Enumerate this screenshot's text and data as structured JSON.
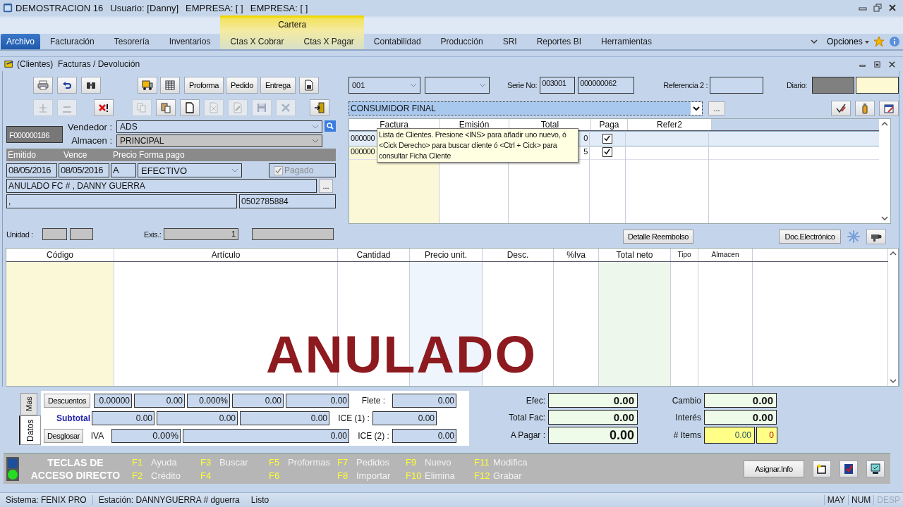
{
  "window": {
    "title": "DEMOSTRACION 16",
    "user": "Usuario: [Danny]",
    "company_1": "EMPRESA: [   ]",
    "company_2": "EMPRESA: [   ]"
  },
  "ribbon": {
    "group_label": "Cartera",
    "options": "Opciones",
    "tabs": [
      {
        "label": "Archivo",
        "selected": true,
        "group": false
      },
      {
        "label": "Facturación",
        "selected": false,
        "group": false
      },
      {
        "label": "Tesorería",
        "selected": false,
        "group": false
      },
      {
        "label": "Inventarios",
        "selected": false,
        "group": false
      },
      {
        "label": "Ctas X Cobrar",
        "selected": false,
        "group": true
      },
      {
        "label": "Ctas X Pagar",
        "selected": false,
        "group": true
      },
      {
        "label": "Contabilidad",
        "selected": false,
        "group": false
      },
      {
        "label": "Producción",
        "selected": false,
        "group": false
      },
      {
        "label": "SRI",
        "selected": false,
        "group": false
      },
      {
        "label": "Reportes BI",
        "selected": false,
        "group": false
      },
      {
        "label": "Herramientas",
        "selected": false,
        "group": false
      }
    ]
  },
  "document": {
    "title": "(Clientes)  Facturas / Devolución"
  },
  "toolbar": {
    "row_1": [
      {
        "kind": "icon"
      },
      {
        "kind": "icon"
      },
      {
        "kind": "icon"
      },
      {
        "kind": "icon"
      },
      {
        "kind": "icon"
      },
      {
        "kind": "text",
        "label": "Proforma"
      },
      {
        "kind": "text",
        "label": "Pedido"
      },
      {
        "kind": "text",
        "label": "Entrega"
      },
      {
        "kind": "icon"
      }
    ],
    "row_2": [
      {
        "kind": "icon",
        "disabled": true
      },
      {
        "kind": "icon",
        "disabled": true
      },
      {
        "kind": "icon",
        "disabled": false
      },
      {
        "kind": "icon",
        "disabled": true
      },
      {
        "kind": "icon",
        "disabled": false
      },
      {
        "kind": "icon",
        "disabled": false
      },
      {
        "kind": "icon",
        "disabled": true
      },
      {
        "kind": "icon",
        "disabled": true
      },
      {
        "kind": "icon",
        "disabled": true
      },
      {
        "kind": "icon",
        "disabled": true
      },
      {
        "kind": "icon",
        "disabled": false
      }
    ]
  },
  "form": {
    "invoice_no": "F000000186",
    "vendedor_label": "Vendedor :",
    "vendedor": "ADS",
    "almacen_label": "Almacen :",
    "almacen": "PRINCIPAL",
    "headers": [
      "Emitido",
      "Vence",
      "Precio",
      "Forma pago"
    ],
    "emitido": "08/05/2016",
    "vence": "08/05/2016",
    "precio": "A",
    "forma_pago": "EFECTIVO",
    "pagado": {
      "label": "Pagado",
      "checked": true,
      "disabled": true
    },
    "note": "ANULADO FC # , DANNY GUERRA",
    "more": "...",
    "address": ",",
    "id_number": "0502785884",
    "unidad_label": "Unidad :",
    "exis_label": "Exis.:",
    "exis": "1"
  },
  "header_right": {
    "series": "001",
    "serie_label": "Serie No:",
    "serie_1": "003001",
    "serie_2": "000000062",
    "ref_label": "Referencia 2 :",
    "diario_label": "Diario:",
    "client": "CONSUMIDOR FINAL",
    "more": "..."
  },
  "invoices": {
    "columns": [
      "Factura",
      "Emisión",
      "Total",
      "Paga",
      "Refer2"
    ],
    "rows": [
      {
        "factura": "000000",
        "total": "0",
        "paga": true,
        "selected": true
      },
      {
        "factura": "000000",
        "total": "5",
        "paga": true,
        "selected": false
      }
    ]
  },
  "tooltip": "Lista de Clientes. Presione <INS> para añadir uno nuevo, ó <Cick Derecho> para buscar cliente ó <Ctrl + Cick> para consultar Ficha Cliente",
  "buttons_right": [
    "Detalle Reembolso",
    "Doc.Electrónico"
  ],
  "items": {
    "columns": [
      "Código",
      "Artículo",
      "Cantidad",
      "Precio unit.",
      "Desc.",
      "%Iva",
      "Total  neto",
      "Tipo",
      "Almacen"
    ],
    "stamp": "ANULADO"
  },
  "totals": {
    "tabs": [
      {
        "label": "Mas",
        "selected": false
      },
      {
        "label": "Datos",
        "selected": true
      }
    ],
    "descuentos": "Descuentos",
    "discount_values": [
      "0.00000",
      "0.00",
      "0.000%",
      "0.00",
      "0.00"
    ],
    "subtotal_label": "Subtotal",
    "subtotal_values": [
      "0.00",
      "0.00",
      "0.00"
    ],
    "desglosar": "Desglosar",
    "iva_label": "IVA",
    "iva_values": [
      "0.00%",
      "0.00"
    ],
    "extras": [
      {
        "label": "Flete :",
        "value": "0.00"
      },
      {
        "label": "ICE (1) :",
        "value": "0.00"
      },
      {
        "label": "ICE (2) :",
        "value": "0.00"
      }
    ]
  },
  "payment": {
    "left": [
      {
        "label": "Efec:",
        "value": "0.00"
      },
      {
        "label": "Total Fac:",
        "value": "0.00"
      },
      {
        "label": "A Pagar :",
        "value": "0.00"
      }
    ],
    "cambio_label": "Cambio",
    "cambio": "0.00",
    "interes_label": "Interés",
    "interes": "0.00",
    "items_label": "# Items",
    "items_qty": "0.00",
    "items_count": "0"
  },
  "shortcuts": {
    "title_1": "TECLAS DE",
    "title_2": "ACCESO DIRECTO",
    "keys": [
      {
        "key": "F1",
        "label": "Ayuda"
      },
      {
        "key": "F2",
        "label": "Crédito"
      },
      {
        "key": "F3",
        "label": "Buscar"
      },
      {
        "key": "F4"
      },
      {
        "key": "F5",
        "label": "Proformas"
      },
      {
        "key": "F6"
      },
      {
        "key": "F7",
        "label": "Pedidos"
      },
      {
        "key": "F8",
        "label": "Importar"
      },
      {
        "key": "F9",
        "label": "Nuevo"
      },
      {
        "key": "F10",
        "label": "Elimina"
      },
      {
        "key": "F11",
        "label": "Modifica"
      },
      {
        "key": "F12",
        "label": "Grabar"
      }
    ],
    "assign": "Asignar.Info"
  },
  "status_bar": {
    "items": [
      "Sistema: FENIX PRO",
      "Estación: DANNYGUERRA # dguerra",
      "Listo"
    ],
    "indicators": [
      {
        "label": "MAY",
        "on": true
      },
      {
        "label": "NUM",
        "on": true
      },
      {
        "label": "DESP",
        "on": false
      }
    ]
  }
}
